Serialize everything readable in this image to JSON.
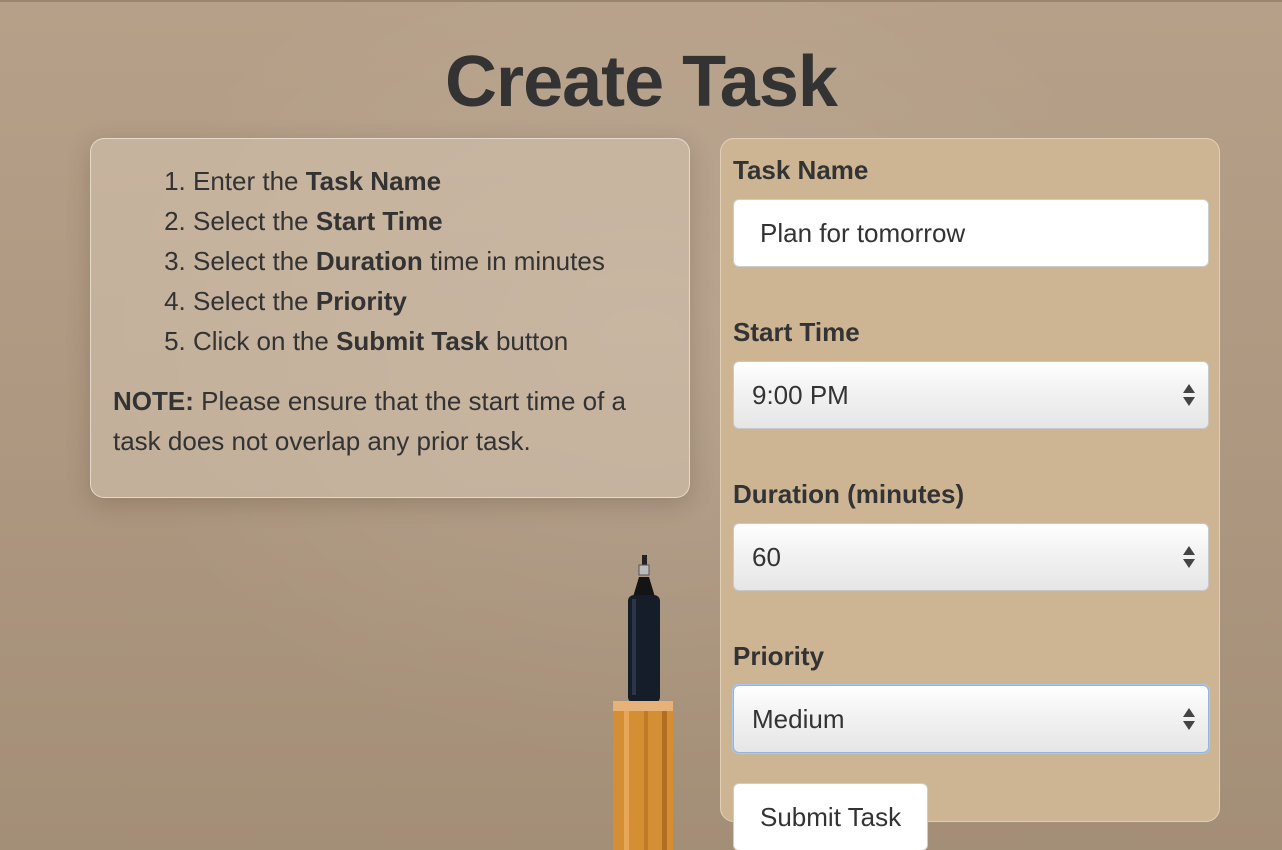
{
  "page": {
    "title": "Create Task"
  },
  "instructions": {
    "steps": [
      {
        "pre": "Enter the ",
        "bold": "Task Name",
        "post": ""
      },
      {
        "pre": "Select the ",
        "bold": "Start Time",
        "post": ""
      },
      {
        "pre": "Select the ",
        "bold": "Duration",
        "post": " time in minutes"
      },
      {
        "pre": "Select the ",
        "bold": "Priority",
        "post": ""
      },
      {
        "pre": "Click on the ",
        "bold": "Submit Task",
        "post": " button"
      }
    ],
    "note_label": "NOTE:",
    "note_text": " Please ensure that the start time of a task does not overlap any prior task."
  },
  "form": {
    "task_name": {
      "label": "Task Name",
      "value": "Plan for tomorrow"
    },
    "start_time": {
      "label": "Start Time",
      "value": "9:00 PM"
    },
    "duration": {
      "label": "Duration (minutes)",
      "value": "60"
    },
    "priority": {
      "label": "Priority",
      "value": "Medium"
    },
    "submit_label": "Submit Task"
  },
  "icons": {
    "select_arrows": "up-down-arrows-icon",
    "background": "pen-image"
  },
  "colors": {
    "background": "#b09a82",
    "form_panel": "#cdb593",
    "text": "#333333",
    "focus_border": "#8fb7e6"
  }
}
